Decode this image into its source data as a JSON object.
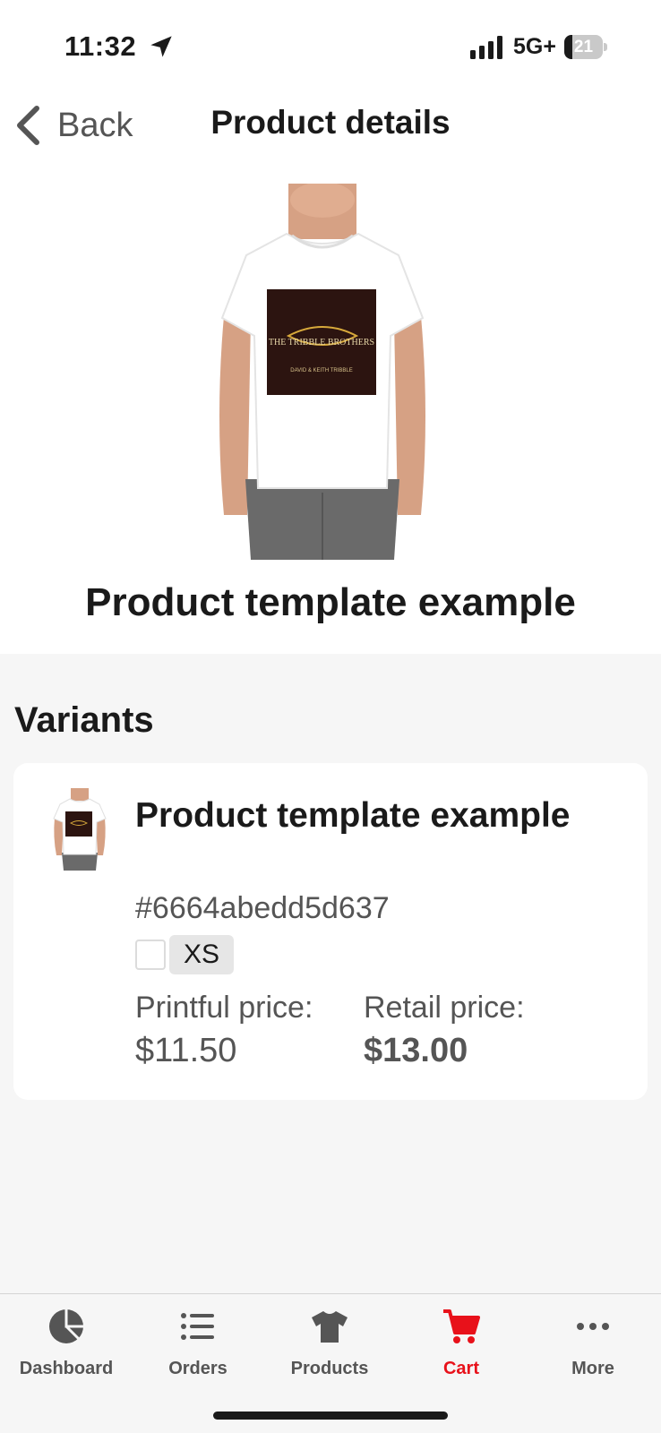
{
  "status_bar": {
    "time": "11:32",
    "network": "5G+",
    "battery_level": "21",
    "icons": [
      "location-arrow-icon",
      "signal-icon",
      "battery-icon"
    ]
  },
  "nav": {
    "back_label": "Back",
    "title": "Product details"
  },
  "product": {
    "image_alt": "t-shirt-mockup",
    "print_text": "THE TRIBBLE BROTHERS",
    "print_subtext": "DAVID & KEITH TRIBBLE",
    "title": "Product template example"
  },
  "variants": {
    "heading": "Variants",
    "items": [
      {
        "name": "Product template example",
        "id": "#6664abedd5d637",
        "size": "XS",
        "printful_price_label": "Printful price:",
        "printful_price": "$11.50",
        "retail_price_label": "Retail price:",
        "retail_price": "$13.00"
      }
    ]
  },
  "tabs": [
    {
      "label": "Dashboard",
      "icon": "pie-chart-icon",
      "active": false
    },
    {
      "label": "Orders",
      "icon": "list-icon",
      "active": false
    },
    {
      "label": "Products",
      "icon": "tshirt-icon",
      "active": false
    },
    {
      "label": "Cart",
      "icon": "cart-icon",
      "active": true
    },
    {
      "label": "More",
      "icon": "more-dots-icon",
      "active": false
    }
  ],
  "colors": {
    "accent": "#e8111a",
    "text_primary": "#1a1a1a",
    "text_secondary": "#555555",
    "background": "#f6f6f6",
    "card": "#ffffff"
  }
}
